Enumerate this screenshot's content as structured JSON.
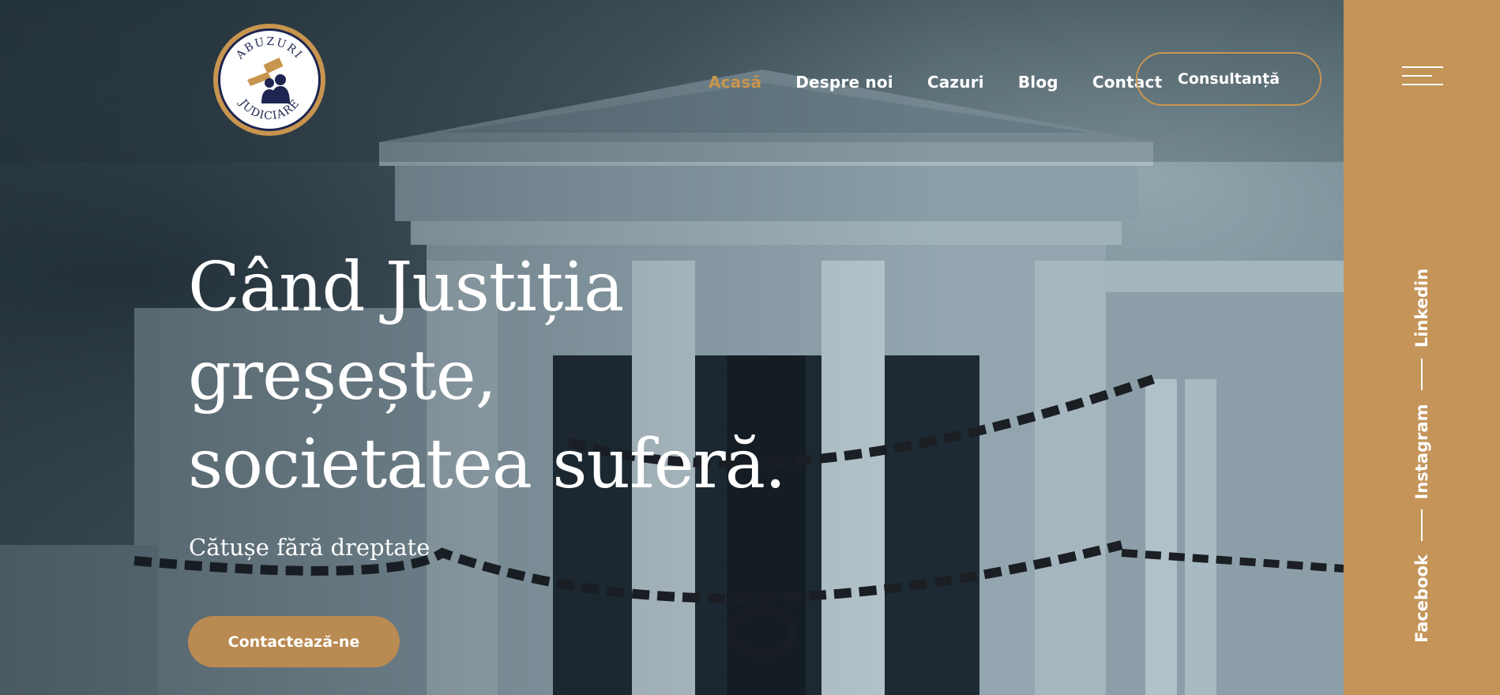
{
  "logo": {
    "text_top": "ABUZURI",
    "text_bottom": "JUDICIARE"
  },
  "nav": {
    "items": [
      {
        "label": "Acasă",
        "active": true
      },
      {
        "label": "Despre noi",
        "active": false
      },
      {
        "label": "Cazuri",
        "active": false
      },
      {
        "label": "Blog",
        "active": false
      },
      {
        "label": "Contact",
        "active": false
      }
    ],
    "cta_label": "Consultanță"
  },
  "hero": {
    "headline_lines": [
      "Când Justiția",
      "greșește,",
      "societatea suferă."
    ],
    "subtitle": "Cătușe fără dreptate",
    "button_label": "Contactează-ne"
  },
  "side_panel": {
    "menu_icon": "hamburger-icon",
    "socials": [
      "Linkedin",
      "Instagram",
      "Facebook"
    ]
  },
  "colors": {
    "accent": "#c8954f",
    "panel": "#c49459",
    "button": "#b98a52",
    "text": "#ffffff",
    "logo_navy": "#1d2550"
  }
}
